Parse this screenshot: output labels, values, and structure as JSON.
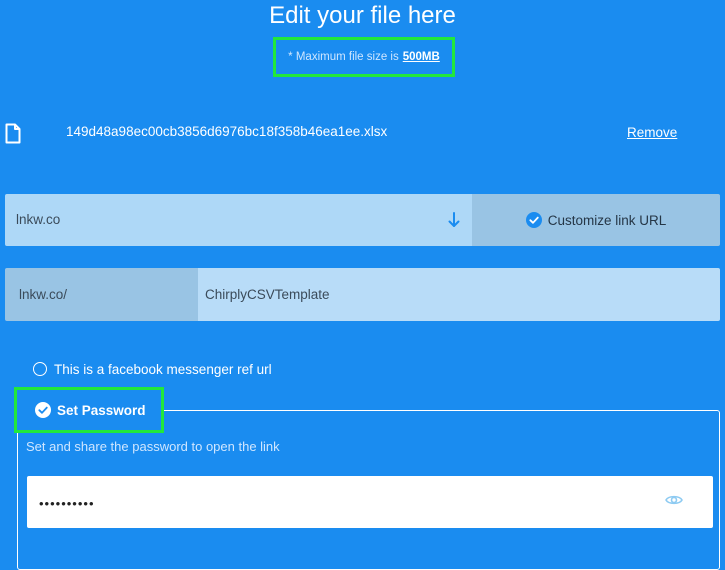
{
  "header": {
    "title": "Edit your file here",
    "size_note_prefix": "* Maximum file size is",
    "size_value": "500MB"
  },
  "file": {
    "icon": "file-icon",
    "name": "149d48a98ec00cb3856d6976bc18f358b46ea1ee.xlsx",
    "remove_label": "Remove"
  },
  "link": {
    "domain_value": "lnkw.co",
    "domain_arrow_icon": "arrow-down-icon",
    "customize_label": "Customize link URL",
    "customize_icon": "check-circle-icon",
    "prefix": "lnkw.co/",
    "slug_value": "ChirplyCSVTemplate"
  },
  "messenger": {
    "label": "This is a facebook messenger ref url"
  },
  "password": {
    "legend_label": "Set Password",
    "legend_icon": "check-circle-icon",
    "hint": "Set and share the password to open the link",
    "value": "••••••••••",
    "eye_icon": "eye-icon"
  },
  "colors": {
    "background": "#1a8cf0",
    "highlight": "#22e83a",
    "input_light": "#b8dcf8",
    "input_dark": "#99c4e4"
  }
}
